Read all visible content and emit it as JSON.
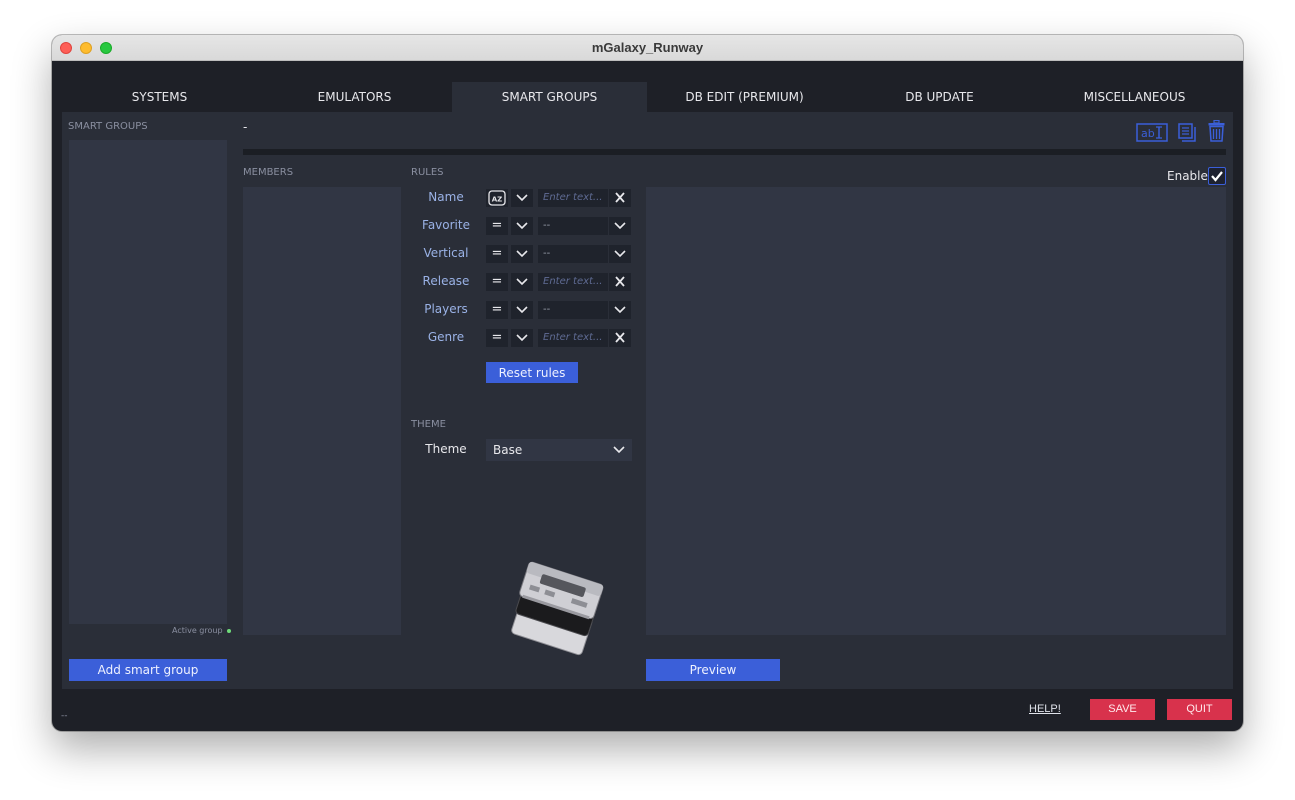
{
  "window": {
    "title": "mGalaxy_Runway"
  },
  "tabs": [
    {
      "label": "SYSTEMS"
    },
    {
      "label": "EMULATORS"
    },
    {
      "label": "SMART GROUPS",
      "active": true
    },
    {
      "label": "DB EDIT (PREMIUM)"
    },
    {
      "label": "DB UPDATE"
    },
    {
      "label": "MISCELLANEOUS"
    }
  ],
  "smart_groups": {
    "header": "SMART GROUPS",
    "items": [],
    "active_group_label": "Active group",
    "add_button": "Add smart group"
  },
  "group": {
    "name": "-",
    "enable_label": "Enable",
    "enabled": true,
    "toolbar_icons": [
      "rename-icon",
      "duplicate-icon",
      "trash-icon"
    ]
  },
  "members": {
    "header": "MEMBERS",
    "items": []
  },
  "rules": {
    "header": "RULES",
    "items": [
      {
        "label": "Name",
        "operator": "AZ",
        "value": "Enter text...",
        "placeholder": true,
        "kind": "text"
      },
      {
        "label": "Favorite",
        "operator": "=",
        "value": "--",
        "placeholder": false,
        "kind": "select"
      },
      {
        "label": "Vertical",
        "operator": "=",
        "value": "--",
        "placeholder": false,
        "kind": "select"
      },
      {
        "label": "Release",
        "operator": "=",
        "value": "Enter text...",
        "placeholder": true,
        "kind": "text"
      },
      {
        "label": "Players",
        "operator": "=",
        "value": "--",
        "placeholder": false,
        "kind": "select"
      },
      {
        "label": "Genre",
        "operator": "=",
        "value": "Enter text...",
        "placeholder": true,
        "kind": "text"
      }
    ],
    "reset_button": "Reset rules"
  },
  "theme": {
    "header": "THEME",
    "label": "Theme",
    "value": "Base"
  },
  "preview": {
    "button": "Preview"
  },
  "footer": {
    "status": "--",
    "help": "HELP!",
    "save": "SAVE",
    "quit": "QUIT"
  },
  "colors": {
    "accent_blue": "#3b5fd9",
    "danger_red": "#d8324c",
    "panel": "#313644",
    "background": "#2a2e38",
    "active_dot": "#6fdc7a"
  }
}
